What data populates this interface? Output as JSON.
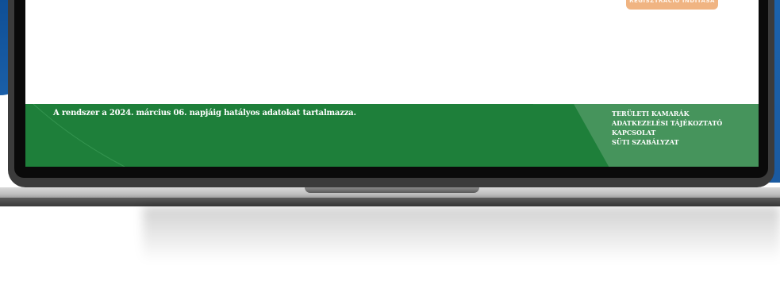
{
  "cta_button": {
    "label": "REGISZTRÁCIÓ INDÍTÁSA"
  },
  "footer": {
    "notice": "A rendszer a 2024. március 06. napjáig hatályos adatokat tartalmazza.",
    "links": [
      "TERÜLETI KAMARÁK",
      "ADATKEZELÉSI TÁJÉKOZTATÓ",
      "KAPCSOLAT",
      "SÜTI SZABÁLYZAT"
    ]
  },
  "colors": {
    "footer_green": "#1e7f3a",
    "footer_panel": "#46945c",
    "cta": "#f0b482",
    "background_blue": "#1a5fa8"
  }
}
